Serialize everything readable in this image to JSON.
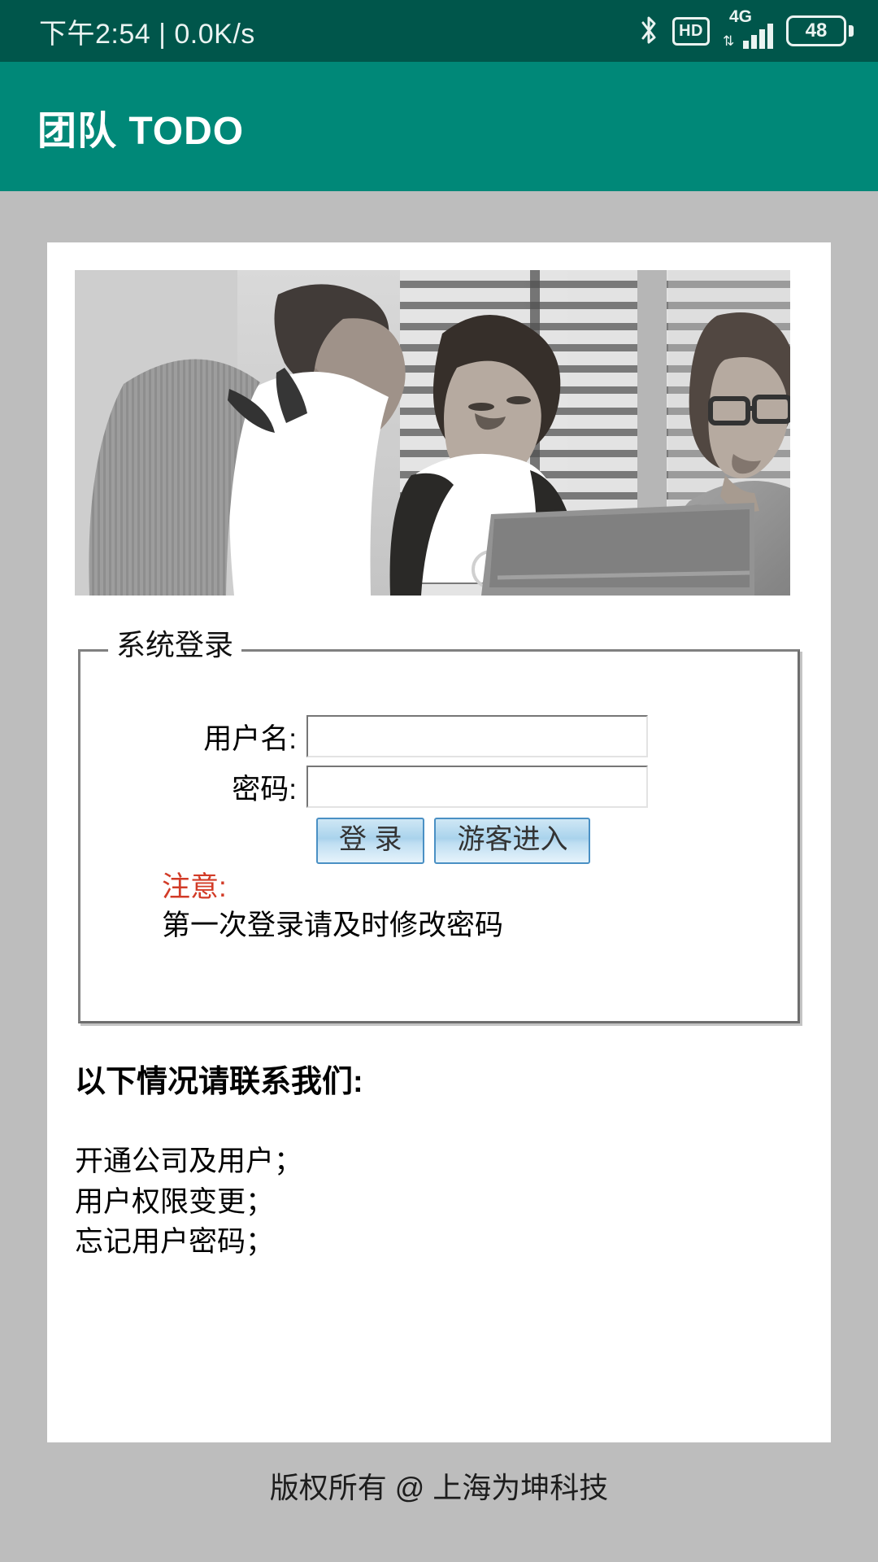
{
  "statusbar": {
    "time_text": "下午2:54 | 0.0K/s",
    "bluetooth_icon": "bluetooth-icon",
    "hd_label": "HD",
    "network_label": "4G",
    "data_arrows": "⇅",
    "battery_level": "48",
    "background_color": "#00564b",
    "foreground_color": "#eaf3f1"
  },
  "appbar": {
    "title": "团队 TODO",
    "background_color": "#008878",
    "title_color": "#ffffff"
  },
  "banner": {
    "alt": "business-team-photo"
  },
  "login": {
    "legend": "系统登录",
    "username_label": "用户名:",
    "username_value": "",
    "username_placeholder": "",
    "password_label": "密码:",
    "password_value": "",
    "password_placeholder": "",
    "submit_label": "登 录",
    "guest_label": "游客进入",
    "notice_title": "注意:",
    "notice_text": "第一次登录请及时修改密码",
    "notice_color": "#d23b27",
    "button_border_color": "#4a90c4"
  },
  "contact": {
    "title": "以下情况请联系我们:",
    "items": [
      "开通公司及用户；",
      "用户权限变更；",
      "忘记用户密码；"
    ]
  },
  "footer": {
    "copyright": "版权所有 @ 上海为坤科技"
  }
}
